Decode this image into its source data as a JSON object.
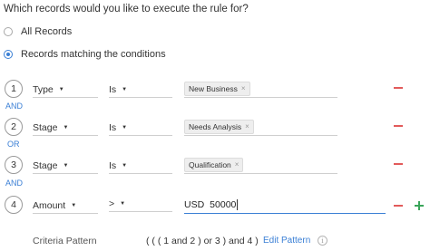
{
  "question": "Which records would you like to execute the rule for?",
  "options": {
    "all_records": "All Records",
    "matching": "Records matching the conditions",
    "selected": "matching"
  },
  "conditions": [
    {
      "number": "1",
      "field": "Type",
      "operator": "Is",
      "value": "New Business"
    },
    {
      "number": "2",
      "field": "Stage",
      "operator": "Is",
      "value": "Needs Analysis"
    },
    {
      "number": "3",
      "field": "Stage",
      "operator": "Is",
      "value": "Qualification"
    },
    {
      "number": "4",
      "field": "Amount",
      "operator": ">",
      "currency": "USD",
      "value": "50000"
    }
  ],
  "connectors": [
    "AND",
    "OR",
    "AND"
  ],
  "chip_remove": "×",
  "criteria": {
    "label": "Criteria Pattern",
    "pattern": "( ( ( 1 and 2 ) or 3 ) and 4 )",
    "edit_link": "Edit Pattern",
    "info_glyph": "i"
  },
  "colors": {
    "accent": "#3a7fd5",
    "remove": "#e25b5b",
    "add": "#3aa55a"
  }
}
